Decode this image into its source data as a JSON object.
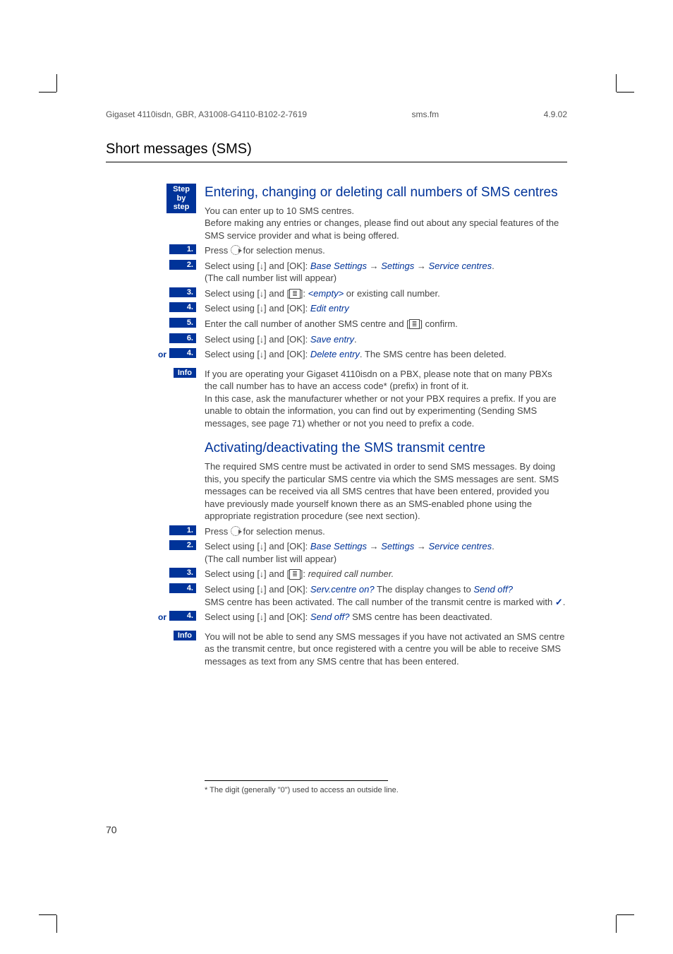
{
  "header": {
    "left": "Gigaset 4110isdn, GBR, A31008-G4110-B102-2-7619",
    "mid": "sms.fm",
    "right": "4.9.02"
  },
  "sectionTitle": "Short messages (SMS)",
  "labels": {
    "stepByStep": "Step\nby\nstep",
    "or": "or",
    "info": "Info"
  },
  "h1": {
    "title": "Entering, changing or deleting call numbers of SMS centres",
    "intro": "You can enter up to 10 SMS centres.\nBefore making any entries or changes, please find out about any special features of the SMS service provider and what is being offered.",
    "steps": [
      {
        "n": "1.",
        "pre": "Press ",
        "post": " for selection menus."
      },
      {
        "n": "2.",
        "t1": "Select using [",
        "t2": "] and [OK]: ",
        "b1": "Base Settings",
        "arr1": " → ",
        "b2": "Settings",
        "arr2": " → ",
        "b3": "Service centres",
        "t3": ".",
        "extra": "(The call number list will appear)"
      },
      {
        "n": "3.",
        "t1": "Select using [",
        "t2": "] and [",
        "t3": "]: ",
        "b1": "<empty>",
        "t4": " or existing call number."
      },
      {
        "n": "4.",
        "t1": "Select using [",
        "t2": "] and [OK]: ",
        "b1": "Edit entry"
      },
      {
        "n": "5.",
        "t": "Enter the call number of another SMS centre and [",
        "t2": "] confirm."
      },
      {
        "n": "6.",
        "t1": "Select using [",
        "t2": "] and [OK]: ",
        "b1": "Save entry",
        "t3": "."
      },
      {
        "n": "4.",
        "or": true,
        "t1": "Select using [",
        "t2": "] and [OK]: ",
        "b1": "Delete entry",
        "t3": ". The SMS centre has been deleted."
      }
    ],
    "info": "If you are operating your Gigaset 4110isdn on a PBX, please note that on many PBXs the call number has to have an access code* (prefix) in front of it.\nIn this case, ask the manufacturer whether or not your PBX requires a prefix. If you are unable to obtain the information, you can find out by experimenting (Sending SMS messages, see page 71) whether or not you need to prefix a code."
  },
  "h2": {
    "title": "Activating/deactivating the SMS transmit centre",
    "intro": "The required SMS centre must be activated in order to send SMS messages. By doing this, you specify the particular SMS centre via which the SMS messages are sent. SMS messages can be received via all SMS centres that have been entered, provided you have previously made yourself known there as an SMS-enabled phone using the appropriate registration procedure (see next section).",
    "steps": [
      {
        "n": "1.",
        "pre": "Press ",
        "post": " for selection menus."
      },
      {
        "n": "2.",
        "t1": "Select using [",
        "t2": "] and [OK]: ",
        "b1": "Base Settings",
        "arr1": " → ",
        "b2": "Settings",
        "arr2": " → ",
        "b3": "Service centres",
        "t3": ".",
        "extra": "(The call number list will appear)"
      },
      {
        "n": "3.",
        "t1": "Select using [",
        "t2": "] and [",
        "t3": "]: ",
        "it": "required call number."
      },
      {
        "n": "4.",
        "t1": "Select using [",
        "t2": "] and [OK]: ",
        "b1": "Serv.centre on?",
        "t3": " The display changes to ",
        "b2": "Send off?",
        "extra1": "SMS centre has been activated. The call number of the transmit centre is marked with ",
        "extra2": "."
      },
      {
        "n": "4.",
        "or": true,
        "t1": "Select using [",
        "t2": "] and [OK]: ",
        "b1": "Send off?",
        "t3": " SMS centre has been deactivated."
      }
    ],
    "info": "You will not be able to send any SMS messages if you have not activated an SMS centre as the transmit centre, but once registered with a centre you will be able to receive SMS messages as text from any SMS centre that has been entered."
  },
  "footnote": "*    The digit (generally \"0\") used to access an outside line.",
  "pageNum": "70"
}
